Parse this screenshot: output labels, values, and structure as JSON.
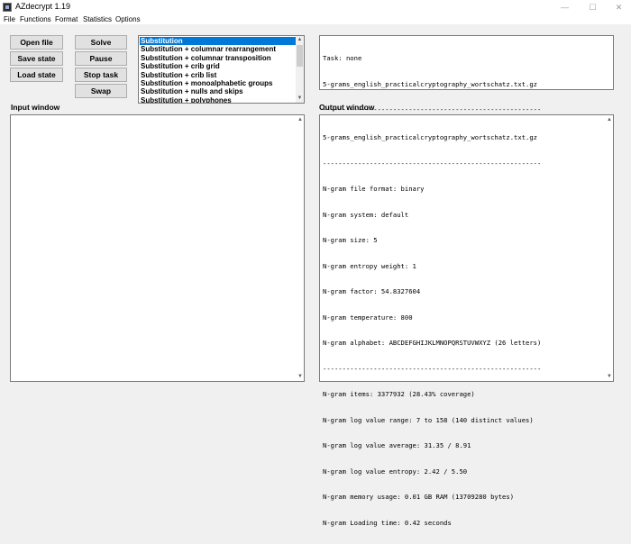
{
  "window": {
    "title": "AZdecrypt 1.19"
  },
  "menu": [
    "File",
    "Functions",
    "Format",
    "Statistics",
    "Options"
  ],
  "buttons": {
    "open_file": "Open file",
    "save_state": "Save state",
    "load_state": "Load state",
    "solve": "Solve",
    "pause": "Pause",
    "stop_task": "Stop task",
    "swap": "Swap"
  },
  "solver_list": [
    "Substitution",
    "Substitution + columnar rearrangement",
    "Substitution + columnar transposition",
    "Substitution + crib grid",
    "Substitution + crib list",
    "Substitution + monoalphabetic groups",
    "Substitution + nulls and skips",
    "Substitution + polyphones"
  ],
  "status_lines": [
    "Task: none",
    "5-grams_english_practicalcryptography_wortschatz.txt.gz",
    "--------------------------------------------------------"
  ],
  "labels": {
    "input": "Input window",
    "output": "Output window"
  },
  "output_lines": [
    "5-grams_english_practicalcryptography_wortschatz.txt.gz",
    "--------------------------------------------------------",
    "N-gram file format: binary",
    "N-gram system: default",
    "N-gram size: 5",
    "N-gram entropy weight: 1",
    "N-gram factor: 54.8327604",
    "N-gram temperature: 800",
    "N-gram alphabet: ABCDEFGHIJKLMNOPQRSTUVWXYZ (26 letters)",
    "--------------------------------------------------------",
    "N-gram items: 3377932 (28.43% coverage)",
    "N-gram log value range: 7 to 158 (140 distinct values)",
    "N-gram log value average: 31.35 / 8.91",
    "N-gram log value entropy: 2.42 / 5.50",
    "N-gram memory usage: 0.01 GB RAM (13709280 bytes)",
    "N-gram Loading time: 0.42 seconds"
  ]
}
